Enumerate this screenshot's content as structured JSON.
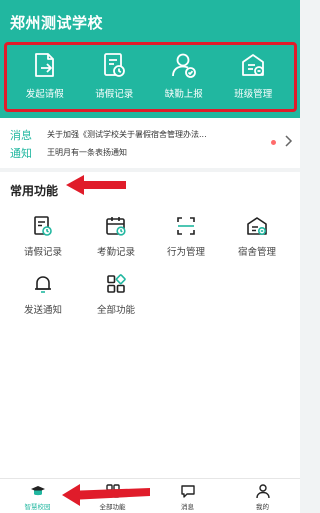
{
  "header": {
    "title": "郑州测试学校",
    "quick_actions": [
      {
        "label": "发起请假",
        "icon": "leave-request-icon"
      },
      {
        "label": "请假记录",
        "icon": "leave-record-icon"
      },
      {
        "label": "缺勤上报",
        "icon": "absence-report-icon"
      },
      {
        "label": "班级管理",
        "icon": "class-management-icon"
      }
    ]
  },
  "notice": {
    "tag_line1": "消息",
    "tag_line2": "通知",
    "items": [
      "关于加强《测试学校关于暑假宿舍管理办法...",
      "王明月有一条表扬通知"
    ],
    "unread_dot_color": "#ff6b6b"
  },
  "common_functions": {
    "title": "常用功能",
    "items": [
      {
        "label": "请假记录",
        "icon": "leave-record-icon"
      },
      {
        "label": "考勤记录",
        "icon": "attendance-record-icon"
      },
      {
        "label": "行为管理",
        "icon": "behavior-management-icon"
      },
      {
        "label": "宿舍管理",
        "icon": "dormitory-management-icon"
      },
      {
        "label": "发送通知",
        "icon": "bell-icon"
      },
      {
        "label": "全部功能",
        "icon": "all-functions-icon"
      }
    ]
  },
  "tabbar": {
    "items": [
      {
        "label": "智慧校园",
        "icon": "graduation-cap-icon",
        "active": true
      },
      {
        "label": "全部功能",
        "icon": "grid-icon",
        "active": false
      },
      {
        "label": "消息",
        "icon": "message-icon",
        "active": false
      },
      {
        "label": "我的",
        "icon": "person-icon",
        "active": false
      }
    ]
  },
  "colors": {
    "brand": "#21b7a0",
    "annotation_red": "#e01c2a"
  }
}
